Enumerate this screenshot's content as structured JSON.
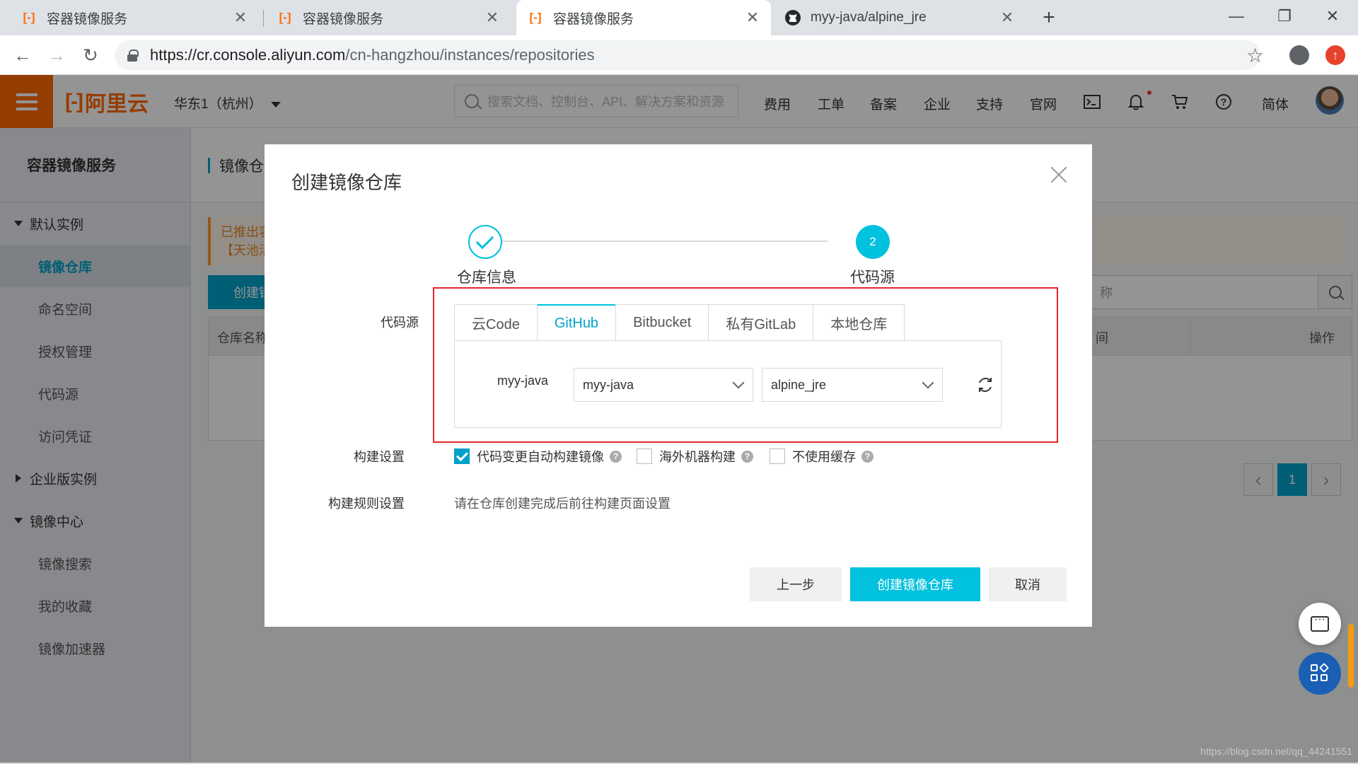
{
  "browser": {
    "tabs": [
      {
        "title": "容器镜像服务",
        "favicon": "aliyun-icon"
      },
      {
        "title": "容器镜像服务",
        "favicon": "aliyun-icon"
      },
      {
        "title": "容器镜像服务",
        "favicon": "aliyun-icon",
        "active": true
      },
      {
        "title": "myy-java/alpine_jre",
        "favicon": "github-icon"
      }
    ],
    "url_host": "https://cr.console.aliyun.com",
    "url_path": "/cn-hangzhou/instances/repositories"
  },
  "console": {
    "brand": "阿里云",
    "region": "华东1（杭州）",
    "search_placeholder": "搜索文档、控制台、API、解决方案和资源",
    "nav": [
      "费用",
      "工单",
      "备案",
      "企业",
      "支持",
      "官网"
    ],
    "lang": "简体"
  },
  "sidebar": {
    "title": "容器镜像服务",
    "groups": [
      {
        "label": "默认实例",
        "expanded": true,
        "items": [
          "镜像仓库",
          "命名空间",
          "授权管理",
          "代码源",
          "访问凭证"
        ],
        "active_index": 0
      },
      {
        "label": "企业版实例",
        "expanded": false,
        "items": []
      },
      {
        "label": "镜像中心",
        "expanded": true,
        "items": [
          "镜像搜索",
          "我的收藏",
          "镜像加速器"
        ]
      }
    ]
  },
  "main": {
    "page_title": "镜像仓",
    "notice_line1": "已推出容",
    "notice_line2": "【天池活",
    "create_button": "创建镜",
    "search_placeholder": "称",
    "col_name": "仓库名称",
    "col_fragment": "间",
    "col_actions": "操作",
    "pager_current": "1"
  },
  "dialog": {
    "title": "创建镜像仓库",
    "steps": [
      {
        "label": "仓库信息",
        "status": "done"
      },
      {
        "label": "代码源",
        "number": "2",
        "status": "current"
      }
    ],
    "source_label": "代码源",
    "source_tabs": [
      "云Code",
      "GitHub",
      "Bitbucket",
      "私有GitLab",
      "本地仓库"
    ],
    "active_tab_index": 1,
    "account_label": "myy-java",
    "org_select_value": "myy-java",
    "repo_select_value": "alpine_jre",
    "build_label": "构建设置",
    "build_options": [
      {
        "label": "代码变更自动构建镜像",
        "checked": true
      },
      {
        "label": "海外机器构建",
        "checked": false
      },
      {
        "label": "不使用缓存",
        "checked": false
      }
    ],
    "rule_label": "构建规则设置",
    "rule_text": "请在仓库创建完成后前往构建页面设置",
    "buttons": {
      "prev": "上一步",
      "create": "创建镜像仓库",
      "cancel": "取消"
    }
  },
  "watermark": "https://blog.csdn.net/qq_44241551",
  "colors": {
    "brand": "#ff6a00",
    "accent": "#00c1de",
    "highlight_frame": "#e5252a"
  }
}
